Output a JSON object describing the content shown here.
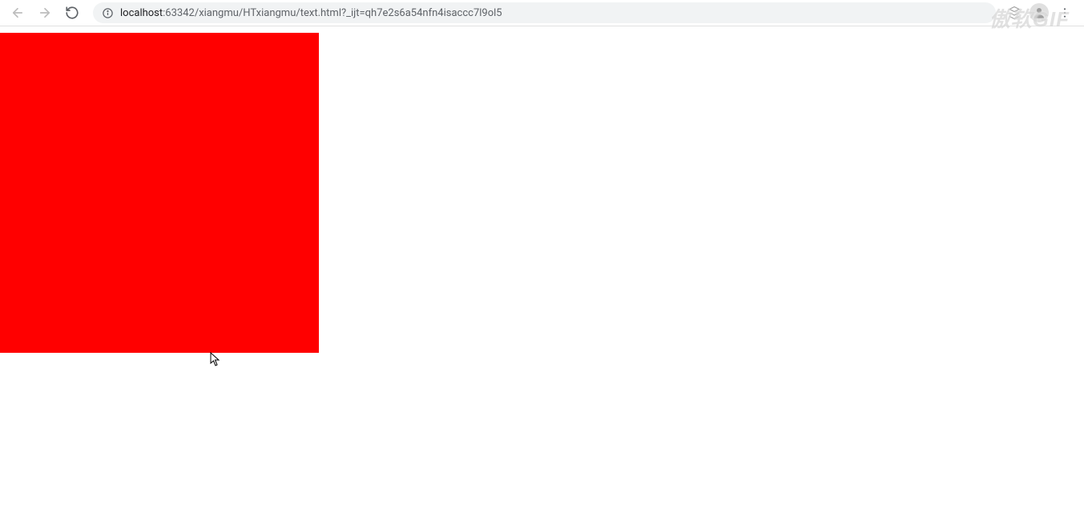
{
  "toolbar": {
    "url_host": "localhost",
    "url_path": ":63342/xiangmu/HTxiangmu/text.html?_ijt=qh7e2s6a54nfn4isaccc7l9ol5"
  },
  "watermark": {
    "text": "傲软GIF"
  },
  "content": {
    "box_color": "#ff0000"
  }
}
